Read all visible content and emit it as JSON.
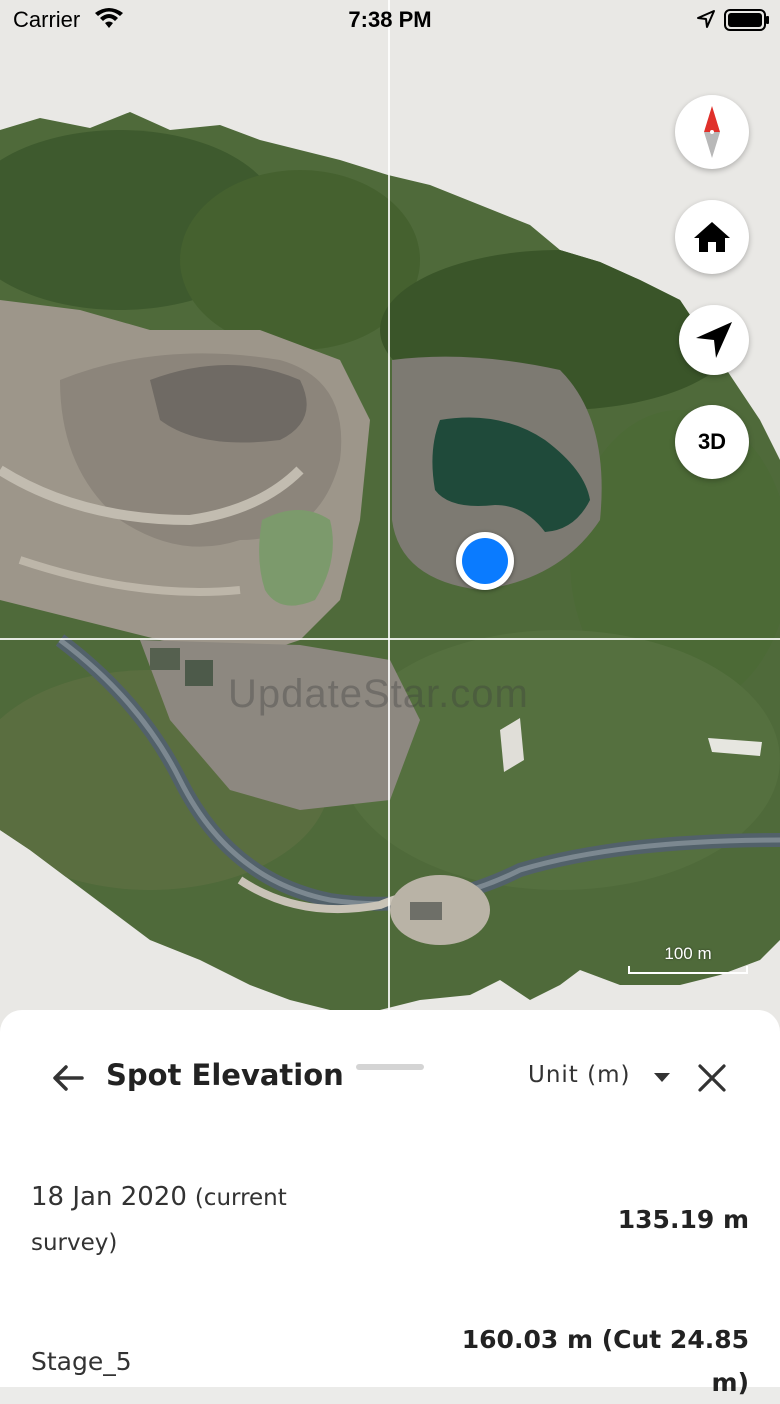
{
  "status_bar": {
    "carrier": "Carrier",
    "time": "7:38 PM"
  },
  "map": {
    "watermark": "UpdateStar.com",
    "scale_label": "100 m",
    "buttons": {
      "compass_icon": "compass-icon",
      "home_icon": "home-icon",
      "locate_icon": "navigation-arrow-icon",
      "three_d_label": "3D"
    }
  },
  "sheet": {
    "title": "Spot Elevation",
    "unit_label": "Unit (m)",
    "rows": [
      {
        "date": "18 Jan 2020",
        "note": "(current survey)",
        "value": "135.19 m"
      },
      {
        "name": "Stage_5",
        "value": "160.03 m (Cut 24.85 m)"
      }
    ]
  },
  "colors": {
    "accent_blue": "#0a7bff",
    "compass_red": "#e0302a"
  }
}
